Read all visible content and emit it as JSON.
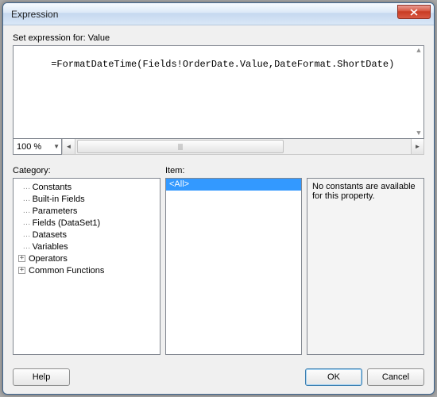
{
  "window": {
    "title": "Expression"
  },
  "editor": {
    "label": "Set expression for: Value",
    "text": "=FormatDateTime(Fields!OrderDate.Value,DateFormat.ShortDate)",
    "zoom": "100 %"
  },
  "panels": {
    "category_label": "Category:",
    "item_label": "Item:",
    "description": "No constants are available for this property."
  },
  "categories": [
    {
      "label": "Constants",
      "expandable": false
    },
    {
      "label": "Built-in Fields",
      "expandable": false
    },
    {
      "label": "Parameters",
      "expandable": false
    },
    {
      "label": "Fields (DataSet1)",
      "expandable": false
    },
    {
      "label": "Datasets",
      "expandable": false
    },
    {
      "label": "Variables",
      "expandable": false
    },
    {
      "label": "Operators",
      "expandable": true
    },
    {
      "label": "Common Functions",
      "expandable": true
    }
  ],
  "items": [
    {
      "label": "<All>",
      "selected": true
    }
  ],
  "buttons": {
    "help": "Help",
    "ok": "OK",
    "cancel": "Cancel"
  }
}
